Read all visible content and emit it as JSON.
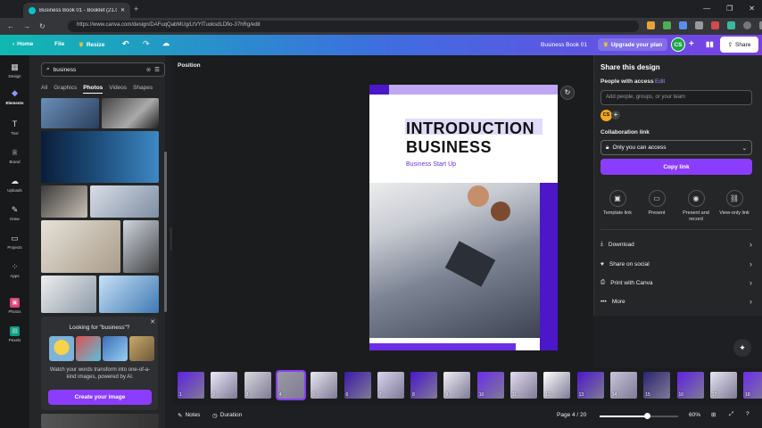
{
  "browser": {
    "tab_title": "Business Book 01 - Booklet (21.0",
    "new_tab": "+",
    "url": "https://www.canva.com/design/DAFuqQabMUg/LtVYlTuoksdLDfio-37hRg/edit",
    "win_min": "—",
    "win_max": "❐",
    "win_close": "✕"
  },
  "header": {
    "home": "Home",
    "file": "File",
    "resize": "Resize",
    "doc_title": "Business Book 01",
    "upgrade": "Upgrade your plan",
    "avatar": "CS",
    "share": "Share"
  },
  "rail": [
    {
      "label": "Design",
      "icon": "▦"
    },
    {
      "label": "Elements",
      "icon": "❖"
    },
    {
      "label": "Text",
      "icon": "T"
    },
    {
      "label": "Brand",
      "icon": "♕"
    },
    {
      "label": "Uploads",
      "icon": "☁"
    },
    {
      "label": "Draw",
      "icon": "✎"
    },
    {
      "label": "Projects",
      "icon": "▭"
    },
    {
      "label": "Apps",
      "icon": "⁘"
    },
    {
      "label": "Photos",
      "icon": "▣"
    },
    {
      "label": "Pexels",
      "icon": "▤"
    }
  ],
  "panel": {
    "search_value": "business",
    "categories": [
      "All",
      "Graphics",
      "Photos",
      "Videos",
      "Shapes"
    ],
    "ai_title": "Looking for \"business\"?",
    "ai_desc": "Watch your words transform into one-of-a-kind images, powered by AI.",
    "ai_button": "Create your image"
  },
  "canvas": {
    "position_label": "Position",
    "page_title_line1": "INTRODUCTION",
    "page_title_line2": "BUSINESS",
    "page_subtitle": "Business Start Up"
  },
  "thumbnails": [
    "1",
    "2",
    "3",
    "4",
    "5",
    "6",
    "7",
    "8",
    "9",
    "10",
    "11",
    "12",
    "13",
    "14",
    "15",
    "16",
    "17",
    "18"
  ],
  "bottom": {
    "notes": "Notes",
    "duration": "Duration",
    "page_indicator": "Page 4 / 20",
    "zoom": "60%",
    "zoom_fraction": 0.6
  },
  "share": {
    "title": "Share this design",
    "people_label": "People with access",
    "edit_link": "Edit",
    "add_placeholder": "Add people, groups, or your team",
    "avatar": "CS",
    "collab_label": "Collaboration link",
    "access_value": "Only you can access",
    "copy_link": "Copy link",
    "options": [
      "Template link",
      "Present",
      "Present and record",
      "View-only link"
    ],
    "rows": [
      "Download",
      "Share on social",
      "Print with Canva",
      "More"
    ]
  },
  "colors": {
    "accent": "#8b3dff",
    "page_purple": "#4b17c9",
    "teal": "#0fb9b1"
  }
}
